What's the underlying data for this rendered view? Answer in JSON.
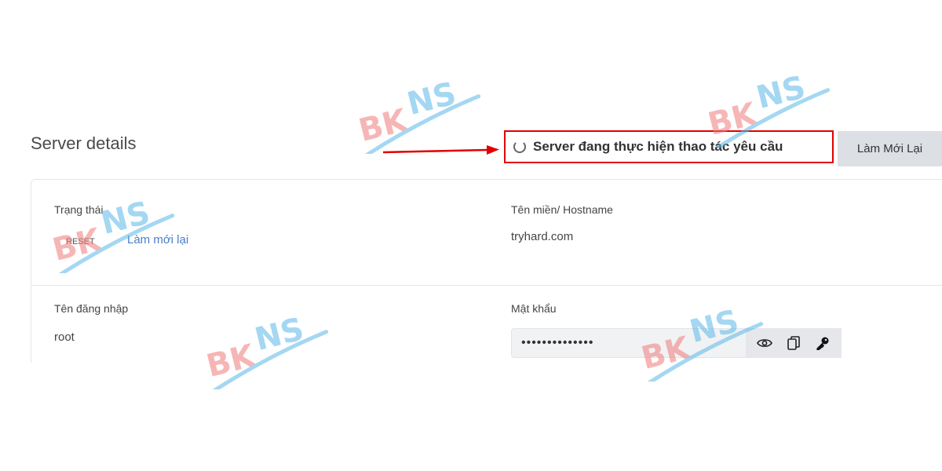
{
  "page": {
    "title": "Server details"
  },
  "banner": {
    "status_text": "Server đang thực hiện thao tác yêu cầu",
    "refresh_label": "Làm Mới Lại"
  },
  "fields": {
    "status": {
      "label": "Trạng thái",
      "badge": "RESET",
      "link": "Làm mới lại"
    },
    "hostname": {
      "label": "Tên miền/ Hostname",
      "value": "tryhard.com"
    },
    "username": {
      "label": "Tên đăng nhập",
      "value": "root"
    },
    "password": {
      "label": "Mật khẩu",
      "masked_value": "••••••••••••••"
    }
  },
  "icons": {
    "arrow": "arrow-right-icon",
    "spinner": "spinner-icon",
    "show": "eye-icon",
    "copy": "copy-icon",
    "key": "key-icon"
  },
  "watermark": {
    "text": "BKNS"
  },
  "colors": {
    "highlight_border": "#e00000",
    "arrow": "#e00000",
    "link": "#4a7ec7",
    "button_bg": "#dcdfe4",
    "watermark_red": "#f07b7b",
    "watermark_blue": "#5bb8e8"
  }
}
